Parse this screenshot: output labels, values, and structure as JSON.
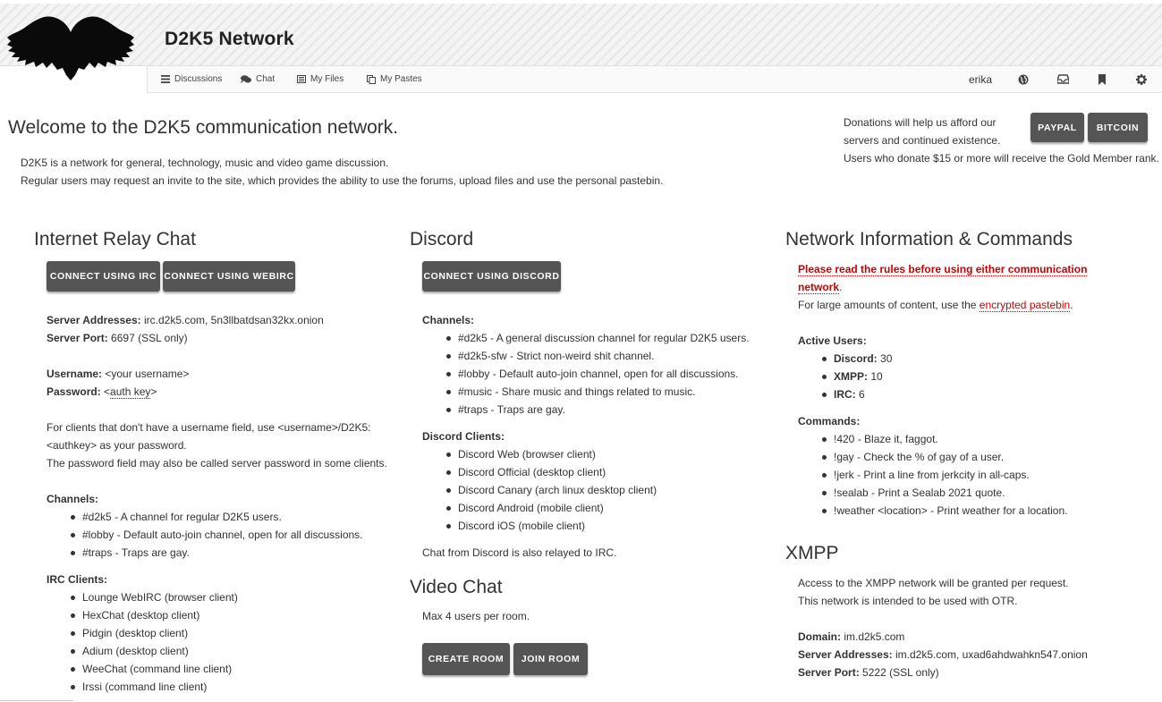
{
  "site": {
    "title": "D2K5 Network"
  },
  "nav": {
    "items": [
      {
        "label": "Discussions",
        "icon": "bars-icon"
      },
      {
        "label": "Chat",
        "icon": "chat-bubbles-icon"
      },
      {
        "label": "My Files",
        "icon": "file-list-icon"
      },
      {
        "label": "My Pastes",
        "icon": "pastes-icon"
      }
    ],
    "username": "erika",
    "right_icons": [
      "globe-icon",
      "inbox-icon",
      "bookmark-icon",
      "gear-icon"
    ]
  },
  "welcome": {
    "title": "Welcome to the D2K5 communication network.",
    "line1": "D2K5 is a network for general, technology, music and video game discussion.",
    "line2": "Regular users may request an invite to the site, which provides the ability to use the forums, upload files and use the personal pastebin."
  },
  "donate": {
    "line1": "Donations will help us afford our",
    "line2": "servers and continued existence.",
    "line3": "Users who donate $15 or more will receive the Gold Member rank.",
    "paypal_label": "PAYPAL",
    "bitcoin_label": "BITCOIN"
  },
  "irc": {
    "title": "Internet Relay Chat",
    "btn_irc": "CONNECT USING IRC",
    "btn_webirc": "CONNECT USING WEBIRC",
    "server_addresses_label": "Server Addresses:",
    "server_addresses": "irc.d2k5.com, 5n3llbatdsan32kx.onion",
    "server_port_label": "Server Port:",
    "server_port": "6697 (SSL only)",
    "username_label": "Username:",
    "username_value": "<your username>",
    "password_label": "Password:",
    "password_prefix": "<",
    "password_value": "auth key",
    "password_suffix": ">",
    "note1": "For clients that don't have a username field, use <username>/D2K5:",
    "note2": "<authkey> as your password.",
    "note3": "The password field may also be called server password in some clients.",
    "channels_label": "Channels:",
    "channels": [
      "#d2k5 - A channel for regular D2K5 users.",
      "#lobby - Default auto-join channel, open for all discussions.",
      "#traps - Traps are gay."
    ],
    "clients_label": "IRC Clients:",
    "clients": [
      "Lounge WebIRC (browser client)",
      "HexChat (desktop client)",
      "Pidgin (desktop client)",
      "Adium (desktop client)",
      "WeeChat (command line client)",
      "Irssi (command line client)"
    ]
  },
  "discord": {
    "title": "Discord",
    "btn": "CONNECT USING DISCORD",
    "channels_label": "Channels:",
    "channels": [
      "#d2k5 - A general discussion channel for regular D2K5 users.",
      "#d2k5-sfw - Strict non-weird shit channel.",
      "#lobby - Default auto-join channel, open for all discussions.",
      "#music - Share music and things related to music.",
      "#traps - Traps are gay."
    ],
    "clients_label": "Discord Clients:",
    "clients": [
      "Discord Web (browser client)",
      "Discord Official (desktop client)",
      "Discord Canary (arch linux desktop client)",
      "Discord Android (mobile client)",
      "Discord iOS (mobile client)"
    ],
    "relay_note": "Chat from Discord is also relayed to IRC."
  },
  "video": {
    "title": "Video Chat",
    "note": "Max 4 users per room.",
    "btn_create": "CREATE ROOM",
    "btn_join": "JOIN ROOM"
  },
  "netinfo": {
    "title": "Network Information & Commands",
    "rules_line1": "Please read the rules before using either communication",
    "rules_line2": "network",
    "rules_period": ".",
    "paste_prefix": "For large amounts of content, use the ",
    "paste_link": "encrypted pastebin",
    "paste_suffix": ".",
    "active_label": "Active Users:",
    "active": [
      {
        "name": "Discord:",
        "count": "30"
      },
      {
        "name": "XMPP:",
        "count": "10"
      },
      {
        "name": "IRC:",
        "count": "6"
      }
    ],
    "commands_label": "Commands:",
    "commands": [
      "!420 - Blaze it, faggot.",
      "!gay - Check the % of gay of a user.",
      "!jerk - Print a line from jerkcity in all-caps.",
      "!sealab - Print a Sealab 2021 quote.",
      "!weather <location> - Print weather for a location."
    ]
  },
  "xmpp": {
    "title": "XMPP",
    "line1": "Access to the XMPP network will be granted per request.",
    "line2": "This network is intended to be used with OTR.",
    "domain_label": "Domain:",
    "domain": "im.d2k5.com",
    "server_addresses_label": "Server Addresses:",
    "server_addresses": "im.d2k5.com, uxad6ahdwahkn547.onion",
    "server_port_label": "Server Port:",
    "server_port": "5222 (SSL only)"
  }
}
